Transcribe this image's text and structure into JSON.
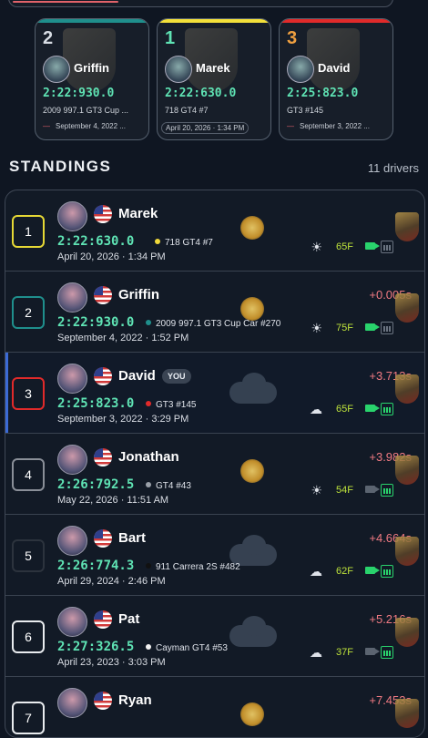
{
  "podium": [
    {
      "rank": "2",
      "name": "Griffin",
      "time": "2:22:930.0",
      "car": "2009 997.1 GT3 Cup ...",
      "date": "September 4, 2022 ...",
      "color": "#1f8f8c"
    },
    {
      "rank": "1",
      "name": "Marek",
      "time": "2:22:630.0",
      "car": "718 GT4 #7",
      "date": "April 20, 2026 · 1:34 PM",
      "color": "#f3e03a"
    },
    {
      "rank": "3",
      "name": "David",
      "time": "2:25:823.0",
      "car": "GT3 #145",
      "date": "September 3, 2022 ...",
      "color": "#e12a2a"
    }
  ],
  "standings": {
    "title": "STANDINGS",
    "count": "11 drivers"
  },
  "rows": [
    {
      "rank": "1",
      "rank_color": "#e6d835",
      "name": "Marek",
      "you": "",
      "time": "2:22:630.0",
      "car": "718 GT4 #7",
      "car_dot": "#f0d93a",
      "date": "April 20, 2026 · 1:34 PM",
      "gap": "",
      "weather": "sun",
      "wx_icon": "☀",
      "temp": "65F",
      "cam": true,
      "tele": false
    },
    {
      "rank": "2",
      "rank_color": "#1f8f8c",
      "name": "Griffin",
      "you": "",
      "time": "2:22:930.0",
      "car": "2009 997.1 GT3 Cup Car #270",
      "car_dot": "#1f8f8c",
      "date": "September 4, 2022 · 1:52 PM",
      "gap": "+0.005s",
      "weather": "sun",
      "wx_icon": "☀",
      "temp": "75F",
      "cam": true,
      "tele": false
    },
    {
      "rank": "3",
      "rank_color": "#e12a2a",
      "name": "David",
      "you": "YOU",
      "time": "2:25:823.0",
      "car": "GT3 #145",
      "car_dot": "#e12a2a",
      "date": "September 3, 2022 · 3:29 PM",
      "gap": "+3.713s",
      "weather": "cloud",
      "wx_icon": "☁",
      "temp": "65F",
      "cam": true,
      "tele": true
    },
    {
      "rank": "4",
      "rank_color": "#8a8f98",
      "name": "Jonathan",
      "you": "",
      "time": "2:26:792.5",
      "car": "GT4 #43",
      "car_dot": "#9aa0a8",
      "date": "May 22, 2026 · 11:51 AM",
      "gap": "+3.982s",
      "weather": "sun",
      "wx_icon": "☀",
      "temp": "54F",
      "cam": false,
      "tele": true
    },
    {
      "rank": "5",
      "rank_color": "#2c333d",
      "name": "Bart",
      "you": "",
      "time": "2:26:774.3",
      "car": "911 Carrera 2S #482",
      "car_dot": "#111111",
      "date": "April 29, 2024 · 2:46 PM",
      "gap": "+4.664s",
      "weather": "cloud",
      "wx_icon": "☁",
      "temp": "62F",
      "cam": true,
      "tele": true
    },
    {
      "rank": "6",
      "rank_color": "#e9ecef",
      "name": "Pat",
      "you": "",
      "time": "2:27:326.5",
      "car": "Cayman GT4 #53",
      "car_dot": "#f2f2f2",
      "date": "April 23, 2023 · 3:03 PM",
      "gap": "+5.216s",
      "weather": "cloud",
      "wx_icon": "☁",
      "temp": "37F",
      "cam": false,
      "tele": true
    },
    {
      "rank": "7",
      "rank_color": "#e9ecef",
      "name": "Ryan",
      "you": "",
      "time": "",
      "car": "",
      "car_dot": "#f2f2f2",
      "date": "",
      "gap": "+7.453s",
      "weather": "sun",
      "wx_icon": "",
      "temp": "",
      "cam": false,
      "tele": false
    }
  ]
}
